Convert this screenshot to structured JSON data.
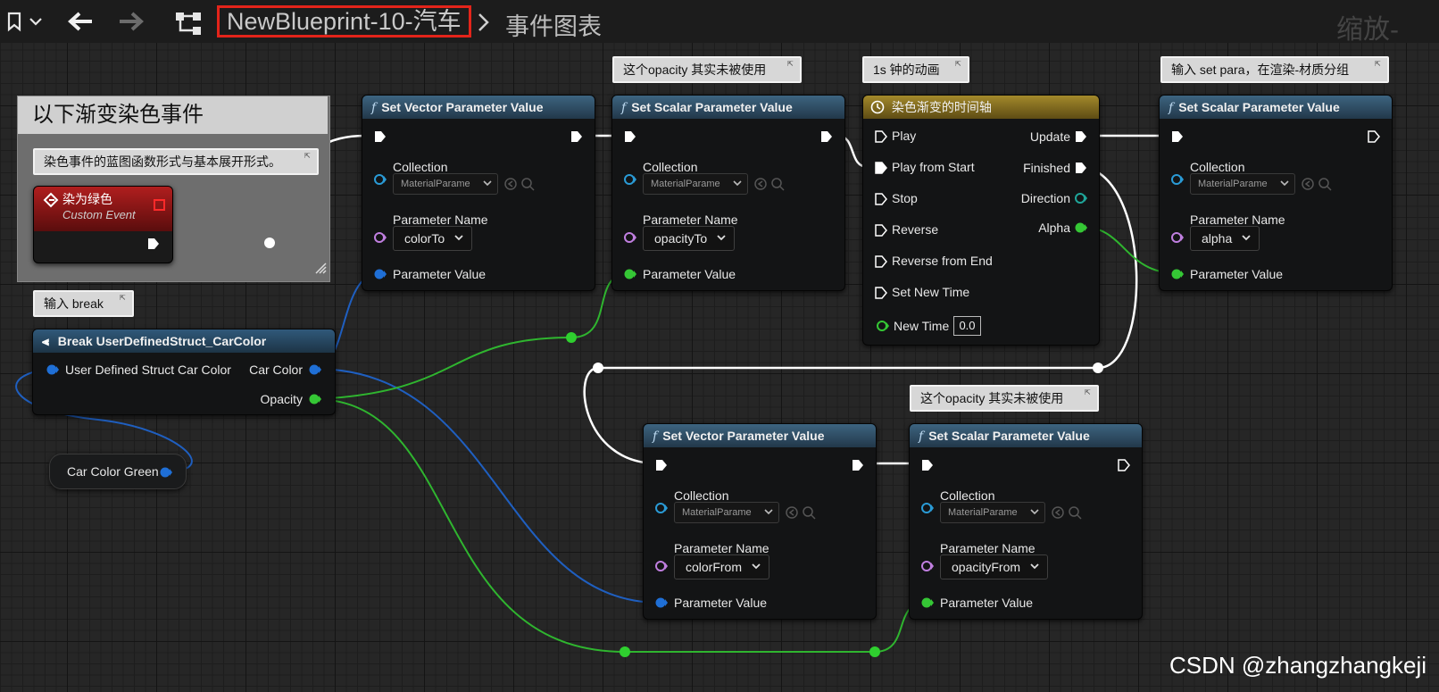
{
  "toolbar": {
    "title": "NewBlueprint-10-汽车",
    "graph": "事件图表",
    "zoom": "缩放-"
  },
  "comment_group": {
    "title": "以下渐变染色事件",
    "note": "染色事件的蓝图函数形式与基本展开形式。"
  },
  "custom_event": {
    "title": "染为绿色",
    "subtitle": "Custom Event"
  },
  "comment_break": "输入 break",
  "break_node": {
    "title": "Break UserDefinedStruct_CarColor",
    "input": "User Defined Struct Car Color",
    "out_color": "Car Color",
    "out_opacity": "Opacity"
  },
  "var_node": {
    "label": "Car Color Green"
  },
  "comment_opacity_1": "这个opacity 其实未被使用",
  "comment_timeline": "1s 钟的动画",
  "comment_setpara": "输入 set para，在渲染-材质分组",
  "comment_opacity_2": "这个opacity 其实未被使用",
  "nodes": {
    "svpv1": {
      "title": "Set Vector Parameter Value",
      "collection": "Collection",
      "collection_value": "MaterialParame",
      "pname": "Parameter Name",
      "pname_value": "colorTo",
      "pvalue": "Parameter Value"
    },
    "sspv1": {
      "title": "Set Scalar Parameter Value",
      "collection": "Collection",
      "collection_value": "MaterialParame",
      "pname": "Parameter Name",
      "pname_value": "opacityTo",
      "pvalue": "Parameter Value"
    },
    "sspv2": {
      "title": "Set Scalar Parameter Value",
      "collection": "Collection",
      "collection_value": "MaterialParame",
      "pname": "Parameter Name",
      "pname_value": "alpha",
      "pvalue": "Parameter Value"
    },
    "svpv2": {
      "title": "Set Vector Parameter Value",
      "collection": "Collection",
      "collection_value": "MaterialParame",
      "pname": "Parameter Name",
      "pname_value": "colorFrom",
      "pvalue": "Parameter Value"
    },
    "sspv3": {
      "title": "Set Scalar Parameter Value",
      "collection": "Collection",
      "collection_value": "MaterialParame",
      "pname": "Parameter Name",
      "pname_value": "opacityFrom",
      "pvalue": "Parameter Value"
    }
  },
  "timeline": {
    "title": "染色渐变的时间轴",
    "inputs": [
      "Play",
      "Play from Start",
      "Stop",
      "Reverse",
      "Reverse from End",
      "Set New Time"
    ],
    "new_time": "New Time",
    "new_time_value": "0.0",
    "outputs": {
      "update": "Update",
      "finished": "Finished",
      "direction": "Direction",
      "alpha": "Alpha"
    }
  },
  "watermark": "CSDN @zhangzhangkeji",
  "colors": {
    "exec": "#ffffff",
    "struct": "#1f6fd6",
    "float": "#35c735",
    "name": "#c07fe0",
    "object": "#2a9bd6",
    "highlight": "#e3241a"
  }
}
